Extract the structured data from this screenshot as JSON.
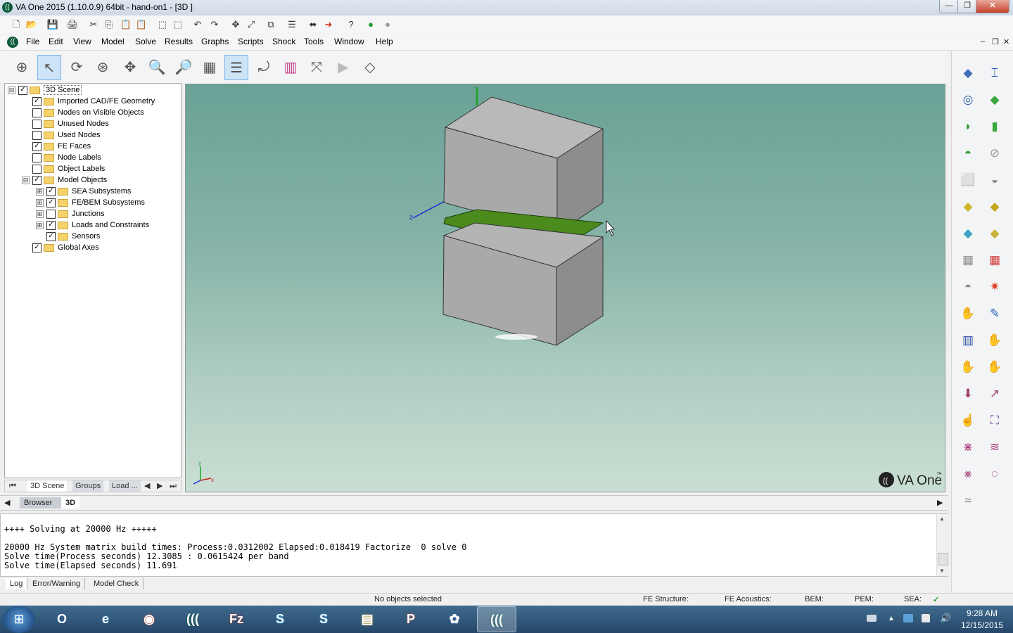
{
  "window": {
    "title": "VA One 2015 (1.10.0.9) 64bit - hand-on1 - [3D ]",
    "min": "—",
    "max": "❐",
    "close": "✕"
  },
  "quick_toolbar": [
    "🗋",
    "📂",
    "💾",
    "🖨",
    "✂",
    "⎘",
    "📋",
    "📋",
    "⬚",
    "⬚",
    "↶",
    "↷",
    "✥",
    "⤢",
    "⧉",
    "☰",
    "⬌",
    "➜",
    "?",
    "●",
    "●"
  ],
  "menu": {
    "items": [
      "File",
      "Edit",
      "View",
      "Model",
      "Solve",
      "Results",
      "Graphs",
      "Scripts",
      "Shock",
      "Tools",
      "Window",
      "Help"
    ],
    "mdi_controls": [
      "–",
      "❐",
      "✕"
    ]
  },
  "main_toolbar": [
    {
      "name": "select-mode-icon",
      "glyph": "⊕"
    },
    {
      "name": "pointer-icon",
      "glyph": "↖"
    },
    {
      "name": "rotate-icon",
      "glyph": "⟳"
    },
    {
      "name": "spin-icon",
      "glyph": "⊛"
    },
    {
      "name": "pan-icon",
      "glyph": "✥"
    },
    {
      "name": "zoom-in-icon",
      "glyph": "🔍"
    },
    {
      "name": "zoom-out-icon",
      "glyph": "🔎"
    },
    {
      "name": "grid-plane-icon",
      "glyph": "▦"
    },
    {
      "name": "layers-icon",
      "glyph": "☰"
    },
    {
      "name": "axis-rotate-icon",
      "glyph": "⤾"
    },
    {
      "name": "color-map-icon",
      "glyph": "▥"
    },
    {
      "name": "fit-view-icon",
      "glyph": "⤧"
    },
    {
      "name": "play-icon",
      "glyph": "▶"
    },
    {
      "name": "export-view-icon",
      "glyph": "◇"
    }
  ],
  "tree": {
    "root": "3D Scene",
    "rows": [
      {
        "label": "3D Scene",
        "indent": 0,
        "expander": "⊟",
        "checked": true,
        "selected": true
      },
      {
        "label": "Imported CAD/FE Geometry",
        "indent": 1,
        "expander": "",
        "checked": true
      },
      {
        "label": "Nodes on Visible Objects",
        "indent": 1,
        "expander": "",
        "checked": false
      },
      {
        "label": "Unused Nodes",
        "indent": 1,
        "expander": "",
        "checked": false
      },
      {
        "label": "Used Nodes",
        "indent": 1,
        "expander": "",
        "checked": false
      },
      {
        "label": "FE Faces",
        "indent": 1,
        "expander": "",
        "checked": true
      },
      {
        "label": "Node Labels",
        "indent": 1,
        "expander": "",
        "checked": false
      },
      {
        "label": "Object Labels",
        "indent": 1,
        "expander": "",
        "checked": false
      },
      {
        "label": "Model Objects",
        "indent": 1,
        "expander": "⊟",
        "checked": true
      },
      {
        "label": "SEA Subsystems",
        "indent": 2,
        "expander": "⊞",
        "checked": true
      },
      {
        "label": "FE/BEM Subsystems",
        "indent": 2,
        "expander": "⊞",
        "checked": true
      },
      {
        "label": "Junctions",
        "indent": 2,
        "expander": "⊞",
        "checked": false
      },
      {
        "label": "Loads and Constraints",
        "indent": 2,
        "expander": "⊞",
        "checked": true
      },
      {
        "label": "Sensors",
        "indent": 2,
        "expander": "",
        "checked": true
      },
      {
        "label": "Global Axes",
        "indent": 1,
        "expander": "",
        "checked": true
      }
    ]
  },
  "tree_tabs": {
    "first": "⏮",
    "tab1": "3D Scene",
    "tab2": "Groups",
    "tab3": "Load ...",
    "prev": "◀",
    "next": "▶",
    "last": "⏭"
  },
  "viewport": {
    "axis_z_label": "z",
    "axis_y_label": "y",
    "axis_x_label": "x",
    "logo_text": "VA One",
    "logo_tm": "™",
    "colors": {
      "box_front": "#a9a9a9",
      "box_top": "#bdbdbd",
      "box_side": "#8d8d8d",
      "plate": "#4b8a1d",
      "axis_y": "#1fa52c",
      "axis_z": "#1a2fd6"
    }
  },
  "browser_tabs": {
    "left": "◀",
    "right": "▶",
    "tab1": "Browser",
    "tab2": "3D"
  },
  "log": {
    "lines": [
      "++++ Solving at 20000 Hz +++++",
      "",
      "20000 Hz System matrix build times: Process:0.0312002 Elapsed:0.018419 Factorize  0 solve 0",
      "Solve time(Process seconds) 12.3085 : 0.0615424 per band",
      "Solve time(Elapsed seconds) 11.691"
    ],
    "scroll_up": "▲",
    "scroll_down": "▼"
  },
  "log_tabs": [
    "Log",
    "Error/Warning",
    "Model Check"
  ],
  "status": {
    "message": "No objects selected",
    "fe_structure": "FE Structure:",
    "fe_acoustics": "FE Acoustics:",
    "bem": "BEM:",
    "pem": "PEM:",
    "sea": "SEA:",
    "sea_ok": "✓"
  },
  "palette": [
    {
      "name": "point-source-icon",
      "glyph": "◆",
      "color": "#3d6fb5"
    },
    {
      "name": "beam-icon",
      "glyph": "⌶",
      "color": "#1e56b0"
    },
    {
      "name": "ring-icon",
      "glyph": "◎",
      "color": "#2b63a8"
    },
    {
      "name": "flat-plate-icon",
      "glyph": "◆",
      "color": "#3ea63e"
    },
    {
      "name": "curved-plate-icon",
      "glyph": "◗",
      "color": "#2c9a2c"
    },
    {
      "name": "cylinder-icon",
      "glyph": "▮",
      "color": "#39a839"
    },
    {
      "name": "dome-icon",
      "glyph": "◓",
      "color": "#2e9d2e"
    },
    {
      "name": "pipe-icon",
      "glyph": "⊘",
      "color": "#9a9a9a"
    },
    {
      "name": "cavity-box-icon",
      "glyph": "⬜",
      "color": "#8a8a8a"
    },
    {
      "name": "half-dome-icon",
      "glyph": "◒",
      "color": "#8a8a8a"
    },
    {
      "name": "yellow-panel-icon",
      "glyph": "◆",
      "color": "#d0b42a"
    },
    {
      "name": "panel-load-icon",
      "glyph": "◆",
      "color": "#c3a722"
    },
    {
      "name": "cyan-panel-icon",
      "glyph": "◆",
      "color": "#3aa3c3"
    },
    {
      "name": "panel-stack-icon",
      "glyph": "◆",
      "color": "#c9b23a"
    },
    {
      "name": "fe-mesh-icon",
      "glyph": "▦",
      "color": "#8f8f8f"
    },
    {
      "name": "red-mesh-icon",
      "glyph": "▦",
      "color": "#d24040"
    },
    {
      "name": "shell-mesh-icon",
      "glyph": "◓",
      "color": "#8f8f8f"
    },
    {
      "name": "spark-load-icon",
      "glyph": "✷",
      "color": "#e0402a"
    },
    {
      "name": "hand-connect-icon",
      "glyph": "✋",
      "color": "#555"
    },
    {
      "name": "point-junction-icon",
      "glyph": "✎",
      "color": "#2c64b0"
    },
    {
      "name": "columns-icon",
      "glyph": "▥",
      "color": "#2c4fa0"
    },
    {
      "name": "hand-point-icon",
      "glyph": "✋",
      "color": "#555"
    },
    {
      "name": "hand-line-icon",
      "glyph": "✋",
      "color": "#c03030"
    },
    {
      "name": "hand-area-icon",
      "glyph": "✋",
      "color": "#c03030"
    },
    {
      "name": "force-down-icon",
      "glyph": "⬇",
      "color": "#a04070"
    },
    {
      "name": "force-load-icon",
      "glyph": "↗",
      "color": "#a04070"
    },
    {
      "name": "hand-cursor-icon",
      "glyph": "☝",
      "color": "#444"
    },
    {
      "name": "power-icon",
      "glyph": "⛶",
      "color": "#6a3aa0"
    },
    {
      "name": "diffuse-field-icon",
      "glyph": "⋇",
      "color": "#a03070"
    },
    {
      "name": "wave-field-icon",
      "glyph": "≋",
      "color": "#a03070"
    },
    {
      "name": "tbl-icon",
      "glyph": "⨳",
      "color": "#a03070"
    },
    {
      "name": "spiral-icon",
      "glyph": "◌",
      "color": "#a03070"
    },
    {
      "name": "stack-wave-icon",
      "glyph": "≈",
      "color": "#777"
    }
  ],
  "taskbar": {
    "start": "⊞",
    "apps": [
      {
        "name": "outlook-icon",
        "glyph": "O",
        "color": "#1f5ea8"
      },
      {
        "name": "ie-icon",
        "glyph": "e",
        "color": "#2d8fd8"
      },
      {
        "name": "chrome-icon",
        "glyph": "◉",
        "color": "#dd4b39"
      },
      {
        "name": "vaone-taskbar-icon",
        "glyph": "(((",
        "color": "#0d5c3a"
      },
      {
        "name": "filezilla-icon",
        "glyph": "Fz",
        "color": "#c0261e"
      },
      {
        "name": "skype-busy-icon",
        "glyph": "S",
        "color": "#1a9fe0"
      },
      {
        "name": "skype-icon",
        "glyph": "S",
        "color": "#1a9fe0"
      },
      {
        "name": "explorer-icon",
        "glyph": "▤",
        "color": "#e6c15a"
      },
      {
        "name": "powerpoint-icon",
        "glyph": "P",
        "color": "#c8472a"
      },
      {
        "name": "flower-app-icon",
        "glyph": "✿",
        "color": "#4d79c7"
      },
      {
        "name": "vaone-active-icon",
        "glyph": "(((",
        "color": "#0d5c3a"
      }
    ],
    "time": "9:28 AM",
    "date": "12/15/2015"
  }
}
